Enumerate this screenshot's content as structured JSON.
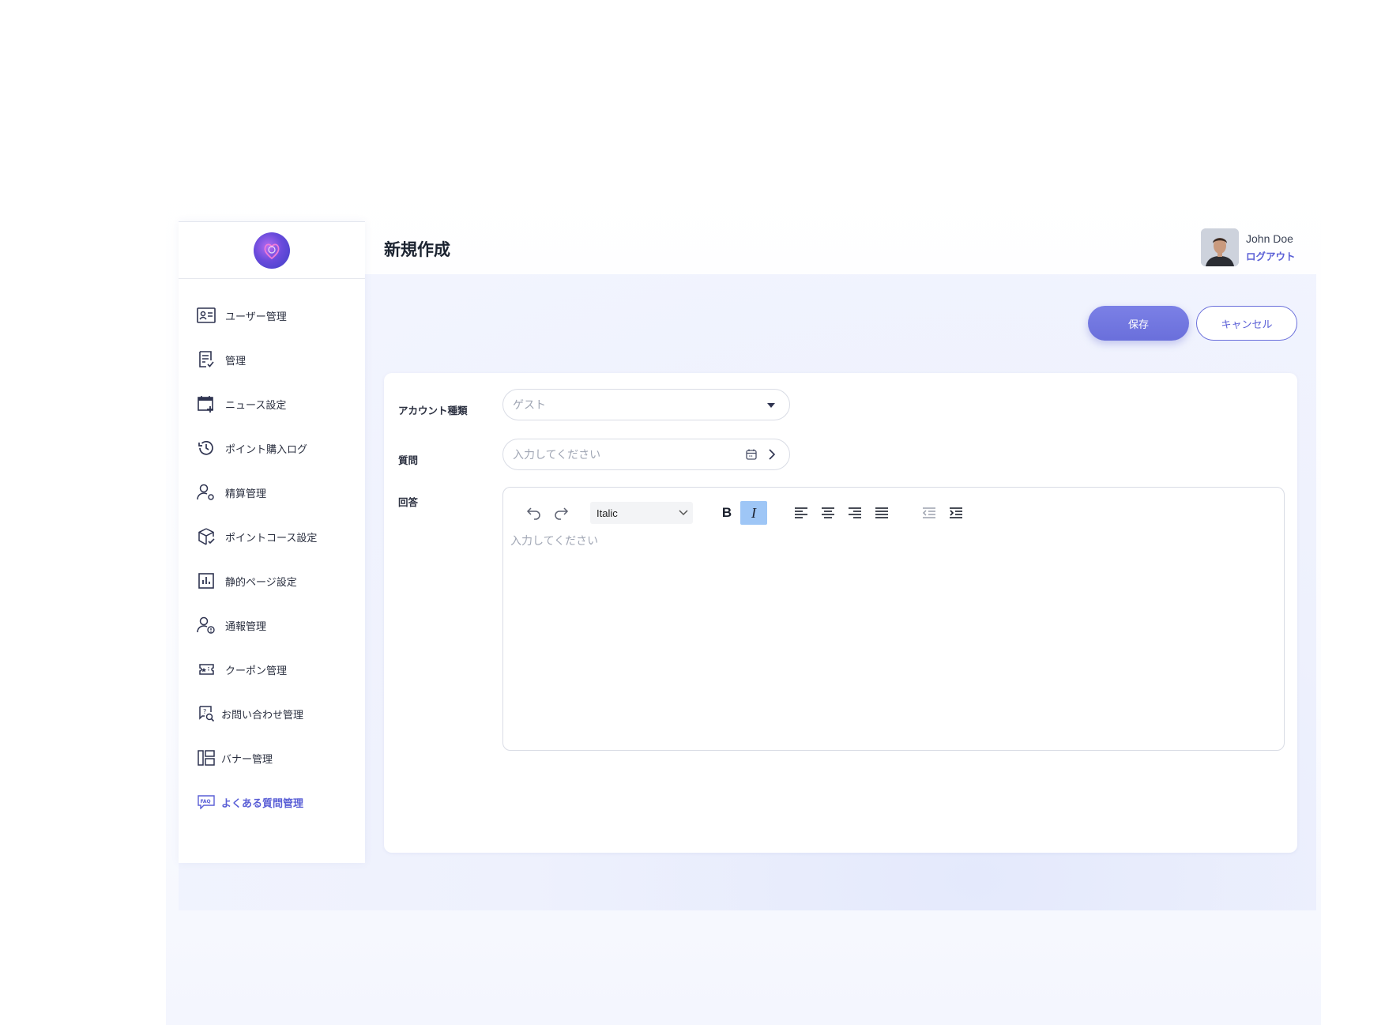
{
  "page": {
    "title": "新規作成"
  },
  "user": {
    "name": "John Doe",
    "logout_label": "ログアウト"
  },
  "actions": {
    "save_label": "保存",
    "cancel_label": "キャンセル"
  },
  "sidebar": {
    "items": [
      {
        "label": "ユーザー管理",
        "icon": "user-card-icon"
      },
      {
        "label": "管理",
        "icon": "document-check-icon"
      },
      {
        "label": "ニュース設定",
        "icon": "calendar-plus-icon"
      },
      {
        "label": "ポイント購入ログ",
        "icon": "history-icon"
      },
      {
        "label": "精算管理",
        "icon": "user-settings-icon"
      },
      {
        "label": "ポイントコース設定",
        "icon": "box-check-icon"
      },
      {
        "label": "静的ページ設定",
        "icon": "bar-chart-icon"
      },
      {
        "label": "通報管理",
        "icon": "user-alert-icon"
      },
      {
        "label": "クーポン管理",
        "icon": "ticket-icon"
      },
      {
        "label": "お問い合わせ管理",
        "icon": "chat-search-icon"
      },
      {
        "label": "バナー管理",
        "icon": "layout-icon"
      },
      {
        "label": "よくある質問管理",
        "icon": "faq-icon",
        "active": true
      }
    ]
  },
  "form": {
    "account_type": {
      "label": "アカウント種類",
      "value": "ゲスト"
    },
    "question": {
      "label": "質問",
      "placeholder": "入力してください"
    },
    "answer": {
      "label": "回答",
      "placeholder": "入力してください",
      "font_select": "Italic",
      "bold_glyph": "B",
      "italic_glyph": "I"
    }
  },
  "colors": {
    "accent": "#6a6fdb",
    "active_nav": "#5a5fd6",
    "italic_highlight": "#9ec6f6"
  }
}
